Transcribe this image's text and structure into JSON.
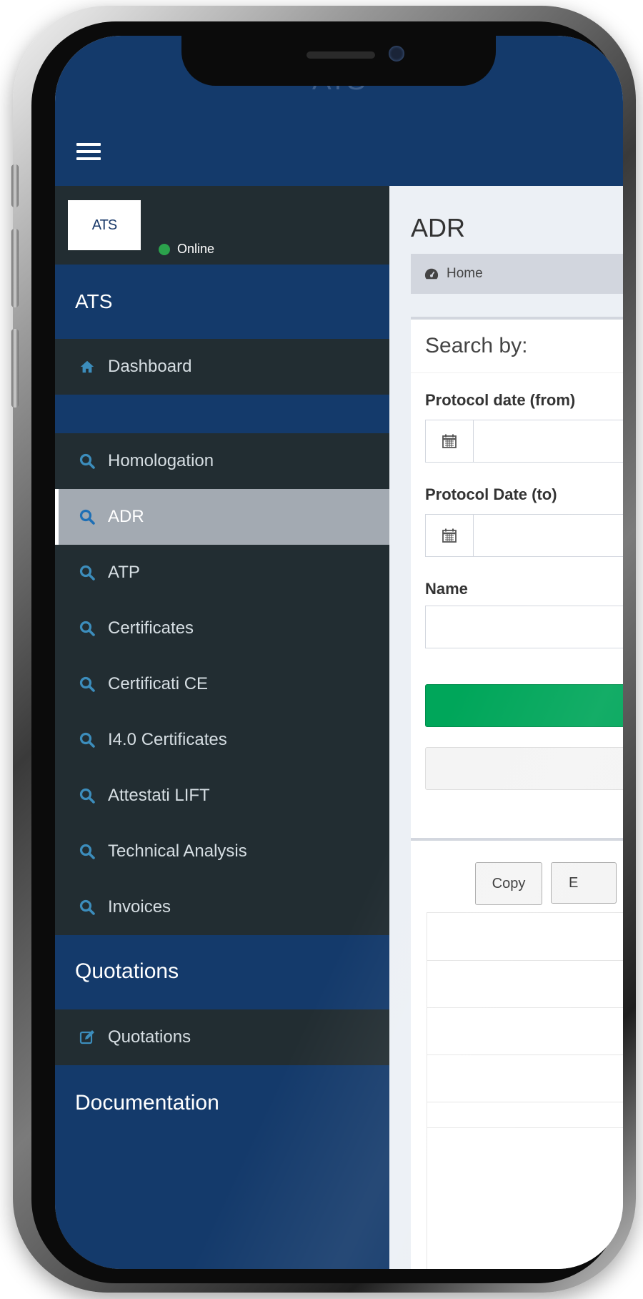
{
  "app": {
    "title": "ATS"
  },
  "user_panel": {
    "logo_text": "ATS",
    "status": "Online"
  },
  "sidebar": {
    "section_main": "ATS",
    "dashboard": "Dashboard",
    "items": [
      {
        "label": "Homologation",
        "icon": "search-icon"
      },
      {
        "label": "ADR",
        "icon": "search-icon",
        "active": true
      },
      {
        "label": "ATP",
        "icon": "search-icon"
      },
      {
        "label": "Certificates",
        "icon": "search-icon"
      },
      {
        "label": "Certificati CE",
        "icon": "search-icon"
      },
      {
        "label": "I4.0 Certificates",
        "icon": "search-icon"
      },
      {
        "label": "Attestati LIFT",
        "icon": "search-icon"
      },
      {
        "label": "Technical Analysis",
        "icon": "search-icon"
      },
      {
        "label": "Invoices",
        "icon": "search-icon"
      }
    ],
    "section_quotations": "Quotations",
    "quotations_item": "Quotations",
    "section_documentation": "Documentation"
  },
  "content": {
    "page_title": "ADR",
    "breadcrumb_home": "Home",
    "search_title": "Search by:",
    "protocol_from_label": "Protocol date (from)",
    "protocol_to_label": "Protocol Date (to)",
    "name_label": "Name",
    "protocol_from_value": "",
    "protocol_to_value": "",
    "name_value": "",
    "copy_button": "Copy",
    "excel_button": "E"
  },
  "colors": {
    "header": "#143a6b",
    "sidebar": "#222d32",
    "active_item": "#a3aab2",
    "icon_blue": "#3c8dbc",
    "online_green": "#2ba24c",
    "search_button": "#00a65a"
  }
}
